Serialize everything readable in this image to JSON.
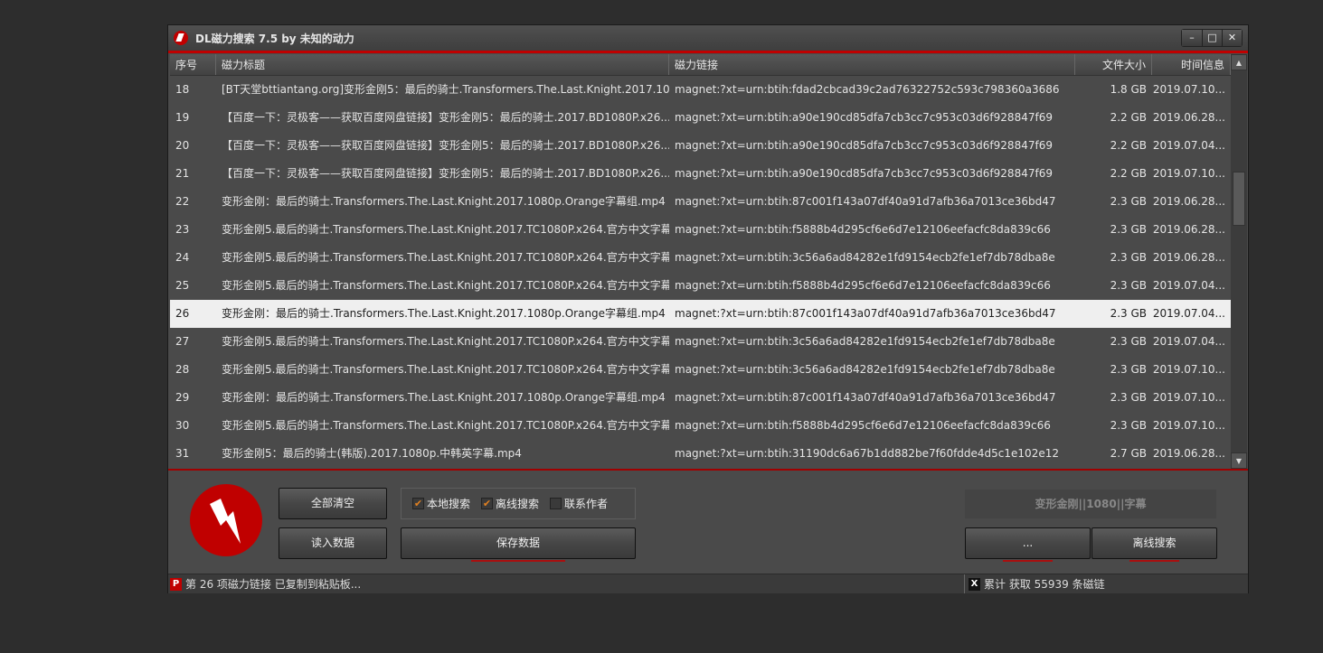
{
  "window": {
    "title": "DL磁力搜索 7.5 by 未知的动力",
    "minimize": "–",
    "maximize": "□",
    "close": "✕"
  },
  "columns": [
    "序号",
    "磁力标题",
    "磁力链接",
    "文件大小",
    "时间信息"
  ],
  "rows": [
    {
      "id": "18",
      "title": "[BT天堂bttiantang.org]变形金刚5：最后的骑士.Transformers.The.Last.Knight.2017.10...",
      "magnet": "magnet:?xt=urn:btih:fdad2cbcad39c2ad76322752c593c798360a3686",
      "size": "1.8 GB",
      "time": "2019.07.10..."
    },
    {
      "id": "19",
      "title": "【百度一下：灵极客——获取百度网盘链接】变形金刚5：最后的骑士.2017.BD1080P.x26...",
      "magnet": "magnet:?xt=urn:btih:a90e190cd85dfa7cb3cc7c953c03d6f928847f69",
      "size": "2.2 GB",
      "time": "2019.06.28..."
    },
    {
      "id": "20",
      "title": "【百度一下：灵极客——获取百度网盘链接】变形金刚5：最后的骑士.2017.BD1080P.x26...",
      "magnet": "magnet:?xt=urn:btih:a90e190cd85dfa7cb3cc7c953c03d6f928847f69",
      "size": "2.2 GB",
      "time": "2019.07.04..."
    },
    {
      "id": "21",
      "title": "【百度一下：灵极客——获取百度网盘链接】变形金刚5：最后的骑士.2017.BD1080P.x26...",
      "magnet": "magnet:?xt=urn:btih:a90e190cd85dfa7cb3cc7c953c03d6f928847f69",
      "size": "2.2 GB",
      "time": "2019.07.10..."
    },
    {
      "id": "22",
      "title": "变形金刚：最后的骑士.Transformers.The.Last.Knight.2017.1080p.Orange字幕组.mp4",
      "magnet": "magnet:?xt=urn:btih:87c001f143a07df40a91d7afb36a7013ce36bd47",
      "size": "2.3 GB",
      "time": "2019.06.28..."
    },
    {
      "id": "23",
      "title": "变形金刚5.最后的骑士.Transformers.The.Last.Knight.2017.TC1080P.x264.官方中文字幕...",
      "magnet": "magnet:?xt=urn:btih:f5888b4d295cf6e6d7e12106eefacfc8da839c66",
      "size": "2.3 GB",
      "time": "2019.06.28..."
    },
    {
      "id": "24",
      "title": "变形金刚5.最后的骑士.Transformers.The.Last.Knight.2017.TC1080P.x264.官方中文字幕...",
      "magnet": "magnet:?xt=urn:btih:3c56a6ad84282e1fd9154ecb2fe1ef7db78dba8e",
      "size": "2.3 GB",
      "time": "2019.06.28..."
    },
    {
      "id": "25",
      "title": "变形金刚5.最后的骑士.Transformers.The.Last.Knight.2017.TC1080P.x264.官方中文字幕...",
      "magnet": "magnet:?xt=urn:btih:f5888b4d295cf6e6d7e12106eefacfc8da839c66",
      "size": "2.3 GB",
      "time": "2019.07.04..."
    },
    {
      "id": "26",
      "title": "变形金刚：最后的骑士.Transformers.The.Last.Knight.2017.1080p.Orange字幕组.mp4",
      "magnet": "magnet:?xt=urn:btih:87c001f143a07df40a91d7afb36a7013ce36bd47",
      "size": "2.3 GB",
      "time": "2019.07.04...",
      "selected": true
    },
    {
      "id": "27",
      "title": "变形金刚5.最后的骑士.Transformers.The.Last.Knight.2017.TC1080P.x264.官方中文字幕...",
      "magnet": "magnet:?xt=urn:btih:3c56a6ad84282e1fd9154ecb2fe1ef7db78dba8e",
      "size": "2.3 GB",
      "time": "2019.07.04..."
    },
    {
      "id": "28",
      "title": "变形金刚5.最后的骑士.Transformers.The.Last.Knight.2017.TC1080P.x264.官方中文字幕...",
      "magnet": "magnet:?xt=urn:btih:3c56a6ad84282e1fd9154ecb2fe1ef7db78dba8e",
      "size": "2.3 GB",
      "time": "2019.07.10..."
    },
    {
      "id": "29",
      "title": "变形金刚：最后的骑士.Transformers.The.Last.Knight.2017.1080p.Orange字幕组.mp4",
      "magnet": "magnet:?xt=urn:btih:87c001f143a07df40a91d7afb36a7013ce36bd47",
      "size": "2.3 GB",
      "time": "2019.07.10..."
    },
    {
      "id": "30",
      "title": "变形金刚5.最后的骑士.Transformers.The.Last.Knight.2017.TC1080P.x264.官方中文字幕...",
      "magnet": "magnet:?xt=urn:btih:f5888b4d295cf6e6d7e12106eefacfc8da839c66",
      "size": "2.3 GB",
      "time": "2019.07.10..."
    },
    {
      "id": "31",
      "title": "变形金刚5：最后的骑士(韩版).2017.1080p.中韩英字幕.mp4",
      "magnet": "magnet:?xt=urn:btih:31190dc6a67b1dd882be7f60fdde4d5c1e102e12",
      "size": "2.7 GB",
      "time": "2019.06.28..."
    }
  ],
  "controls": {
    "clear_all": "全部清空",
    "load_data": "读入数据",
    "save_data": "保存数据",
    "checkboxes": [
      {
        "label": "本地搜索",
        "checked": true
      },
      {
        "label": "离线搜索",
        "checked": true
      },
      {
        "label": "联系作者",
        "checked": false
      }
    ],
    "keyword": "变形金刚||1080||字幕",
    "more": "...",
    "offline_search": "离线搜索"
  },
  "status": {
    "left": "第 26 项磁力链接 已复制到粘贴板...",
    "right": "累计 获取 55939 条磁链"
  },
  "colors": {
    "accent": "#c00000",
    "check": "#e08020"
  }
}
